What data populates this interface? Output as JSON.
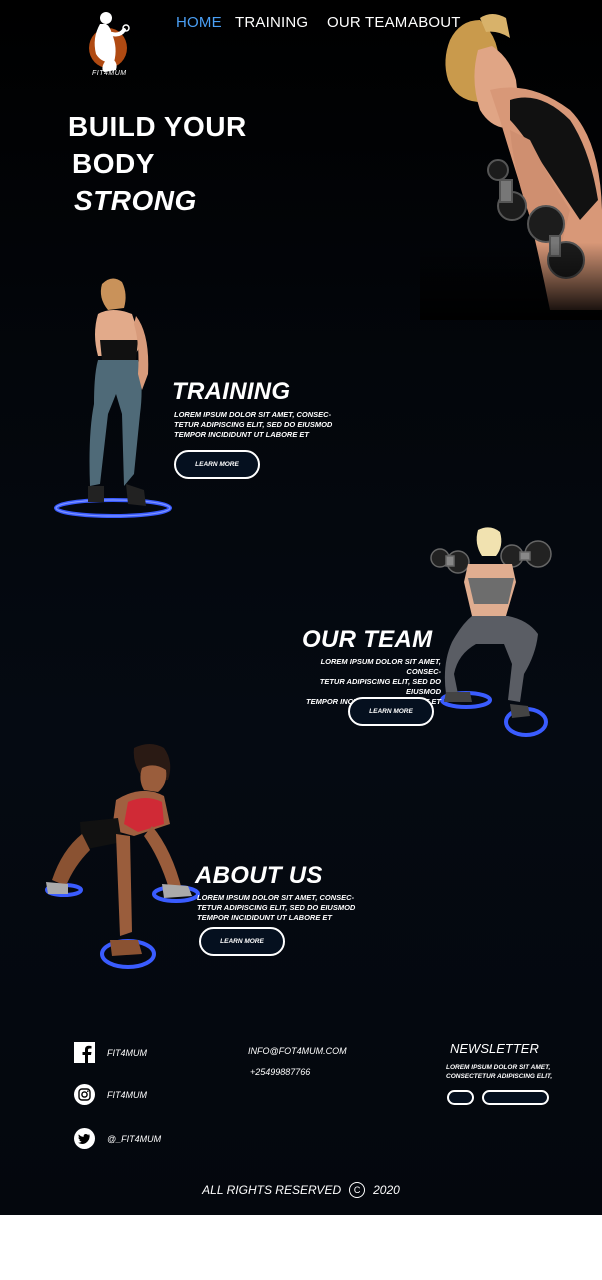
{
  "brand": {
    "logo_text": "FIT4MUM"
  },
  "nav": {
    "items": [
      {
        "label": "HOME",
        "active": true
      },
      {
        "label": "TRAINING",
        "active": false
      },
      {
        "label": "OUR TEAM",
        "active": false
      },
      {
        "label": "ABOUT",
        "active": false
      }
    ],
    "active_color": "#4a9ff5"
  },
  "hero": {
    "line1": "BUILD YOUR",
    "line2": "BODY",
    "line3": "STRONG"
  },
  "sections": {
    "training": {
      "title": "TRAINING",
      "body_l1": "LOREM IPSUM DOLOR SIT AMET, CONSEC-",
      "body_l2": "TETUR ADIPISCING ELIT, SED DO EIUSMOD",
      "body_l3": "TEMPOR INCIDIDUNT UT LABORE ET",
      "button": "LEARN MORE"
    },
    "team": {
      "title": "OUR TEAM",
      "body_l1": "LOREM IPSUM DOLOR SIT AMET, CONSEC-",
      "body_l2": "TETUR ADIPISCING ELIT, SED DO EIUSMOD",
      "body_l3": "TEMPOR INCIDIDUNT UT LABORE ET",
      "button": "LEARN MORE"
    },
    "about": {
      "title": "ABOUT US",
      "body_l1": "LOREM IPSUM DOLOR SIT AMET, CONSEC-",
      "body_l2": "TETUR ADIPISCING ELIT, SED DO EIUSMOD",
      "body_l3": "TEMPOR INCIDIDUNT UT LABORE ET",
      "button": "LEARN MORE"
    }
  },
  "footer": {
    "social": [
      {
        "icon": "facebook-icon",
        "label": "FIT4MUM"
      },
      {
        "icon": "instagram-icon",
        "label": "FIT4MUM"
      },
      {
        "icon": "twitter-icon",
        "label": "@_FIT4MUM"
      }
    ],
    "email": "INFO@FOT4MUM.COM",
    "phone": "+25499887766",
    "newsletter": {
      "title": "NEWSLETTER",
      "body_l1": "LOREM IPSUM DOLOR SIT AMET,",
      "body_l2": "CONSECTETUR ADIPISCING ELIT,"
    },
    "copyright_text": "ALL RIGHTS RESERVED",
    "copyright_symbol": "C",
    "copyright_year": "2020"
  },
  "colors": {
    "background": "#000000",
    "ring_glow": "#3a5cff",
    "button_fill": "#05101f"
  }
}
